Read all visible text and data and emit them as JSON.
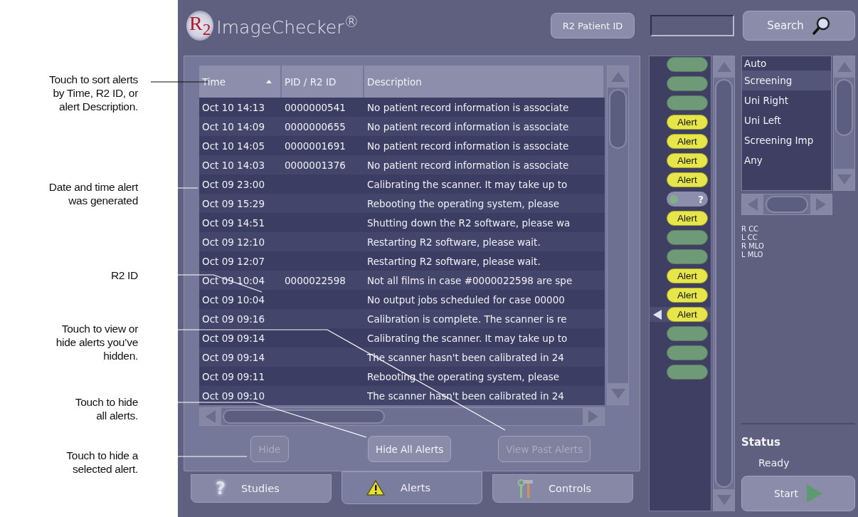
{
  "callouts": [
    {
      "text": "Touch to sort alerts\nby Time, R2 ID, or\nalert Description."
    },
    {
      "text": "Date and time alert\nwas generated"
    },
    {
      "text": "R2 ID"
    },
    {
      "text": "Touch to view or\nhide alerts you’ve\nhidden."
    },
    {
      "text": "Touch to hide\nall alerts."
    },
    {
      "text": "Touch to hide a\nselected alert."
    }
  ],
  "header": {
    "logo": "R$_{2}$",
    "title": "ImageChecker$^{®}$",
    "patient_id_button": "R2 Patient ID",
    "search_button": "Search"
  },
  "table": {
    "columns": [
      {
        "label": "Time",
        "sorted": true
      },
      {
        "label": "PID / R2 ID",
        "sorted": false
      },
      {
        "label": "Description",
        "sorted": false
      }
    ],
    "rows": [
      {
        "time": "Oct 10 14:13",
        "pid": "0000000541",
        "description": "No patient record information is associate"
      },
      {
        "time": "Oct 10 14:09",
        "pid": "0000000655",
        "description": "No patient record information is associate"
      },
      {
        "time": "Oct 10 14:05",
        "pid": "0000001691",
        "description": "No patient record information is associate"
      },
      {
        "time": "Oct 10 14:03",
        "pid": "0000001376",
        "description": "No patient record information is associate"
      },
      {
        "time": "Oct 09 23:00",
        "description": "Calibrating the scanner. It may take up to"
      },
      {
        "time": "Oct 09 15:29",
        "description": "Rebooting the operating system,  please"
      },
      {
        "time": "Oct 09 14:51",
        "description": "Shutting down the R2 software, please wa"
      },
      {
        "time": "Oct 09 12:10",
        "description": "Restarting R2 software,  please wait."
      },
      {
        "time": "Oct 09 12:07",
        "description": "Restarting R2 software,  please wait."
      },
      {
        "time": "Oct 09 10:04",
        "pid": "0000022598",
        "description": "Not all films in case #0000022598 are spe"
      },
      {
        "time": "Oct 09 10:04",
        "description": "No output jobs scheduled for case 00000"
      },
      {
        "time": "Oct 09 09:16",
        "description": "Calibration is complete. The scanner is re"
      },
      {
        "time": "Oct 09 09:14",
        "description": "Calibrating the scanner. It may take up to"
      },
      {
        "time": "Oct 09 09:14",
        "description": "The scanner hasn't been calibrated in 24"
      },
      {
        "time": "Oct 09 09:11",
        "description": "Rebooting the operating system,  please"
      },
      {
        "time": "Oct 09 09:10",
        "description": "The scanner hasn't been calibrated in 24"
      }
    ]
  },
  "buttons": [
    {
      "label": "Hide",
      "disabled": true
    },
    {
      "label": "Hide All Alerts",
      "disabled": false
    },
    {
      "label": "View Past Alerts",
      "disabled": true
    }
  ],
  "tabs": [
    {
      "label": "Studies",
      "kind": "glyph",
      "glyph": "?",
      "selected": false
    },
    {
      "label": "Alerts",
      "kind": "warning",
      "selected": true
    },
    {
      "label": "Controls",
      "kind": "tools",
      "selected": false
    }
  ],
  "slots": [
    {
      "kind": "empty",
      "selected": false
    },
    {
      "kind": "empty",
      "selected": false
    },
    {
      "kind": "empty",
      "selected": false
    },
    {
      "kind": "alert",
      "label": "Alert",
      "selected": false
    },
    {
      "kind": "alert",
      "label": "Alert",
      "selected": false
    },
    {
      "kind": "alert",
      "label": "Alert",
      "selected": false
    },
    {
      "kind": "alert",
      "label": "Alert",
      "selected": false
    },
    {
      "kind": "unknown",
      "label": "?",
      "selected": false
    },
    {
      "kind": "alert",
      "label": "Alert",
      "selected": false
    },
    {
      "kind": "empty",
      "selected": false
    },
    {
      "kind": "empty",
      "selected": false
    },
    {
      "kind": "alert",
      "label": "Alert",
      "selected": false
    },
    {
      "kind": "alert",
      "label": "Alert",
      "selected": false
    },
    {
      "kind": "alert",
      "label": "Alert",
      "selected": true
    },
    {
      "kind": "empty",
      "selected": false
    },
    {
      "kind": "empty",
      "selected": false
    },
    {
      "kind": "empty",
      "selected": false
    }
  ],
  "modes": [
    {
      "label": "Auto",
      "selected": false
    },
    {
      "label": "Screening",
      "selected": true
    },
    {
      "label": "Uni Right",
      "selected": false
    },
    {
      "label": "Uni Left",
      "selected": false
    },
    {
      "label": "Screening Imp",
      "selected": false
    },
    {
      "label": "Any",
      "selected": false
    }
  ],
  "views": [
    "R CC",
    "L CC",
    "R MLO",
    "L MLO"
  ],
  "status": {
    "label": "Status",
    "value": "Ready"
  },
  "start_button": "Start"
}
